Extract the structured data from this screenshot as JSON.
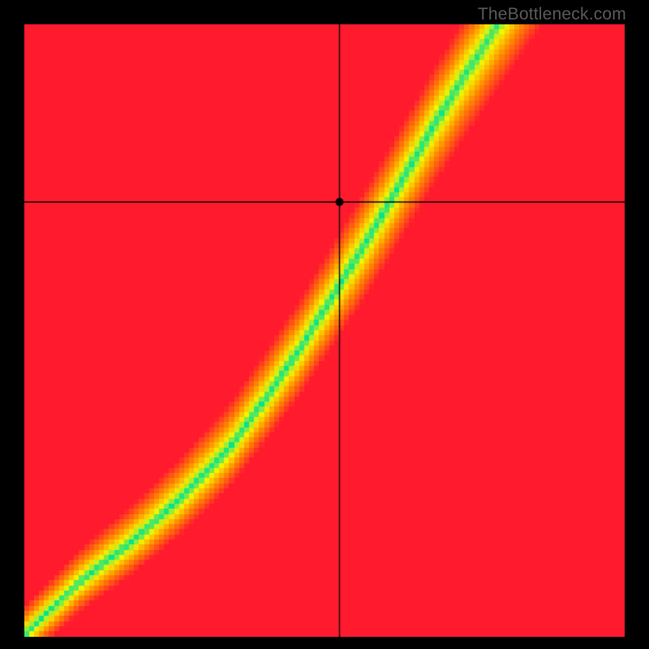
{
  "watermark": "TheBottleneck.com",
  "chart_data": {
    "type": "heatmap",
    "title": "",
    "xlabel": "",
    "ylabel": "",
    "xlim": [
      0,
      1
    ],
    "ylim": [
      0,
      1
    ],
    "grid": false,
    "crosshair": {
      "x": 0.525,
      "y": 0.71
    },
    "marker": {
      "x": 0.525,
      "y": 0.71
    },
    "ridge": {
      "description": "Optimal zone center line (green) as (x,y) pairs in axis-fraction coords, y measured from bottom",
      "points": [
        [
          0.035,
          0.035
        ],
        [
          0.1,
          0.095
        ],
        [
          0.18,
          0.155
        ],
        [
          0.26,
          0.225
        ],
        [
          0.34,
          0.305
        ],
        [
          0.4,
          0.385
        ],
        [
          0.46,
          0.47
        ],
        [
          0.52,
          0.565
        ],
        [
          0.58,
          0.66
        ],
        [
          0.63,
          0.745
        ],
        [
          0.68,
          0.83
        ],
        [
          0.73,
          0.91
        ],
        [
          0.78,
          0.985
        ]
      ]
    },
    "ridge_width_fraction_of_plot": 0.085,
    "color_stops": {
      "0.00": "#00E38F",
      "0.22": "#F4F400",
      "0.55": "#FF8A00",
      "1.00": "#FF1A2E"
    }
  }
}
